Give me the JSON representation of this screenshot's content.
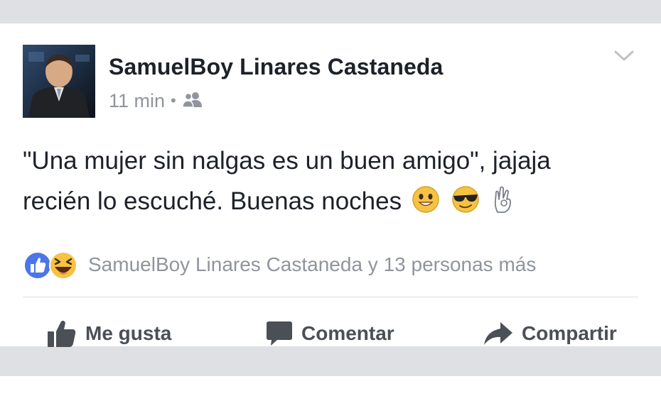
{
  "post": {
    "author": "SamuelBoy Linares Castaneda",
    "time": "11 min",
    "separator": "•",
    "audience_icon": "friends-icon",
    "text_line1": "\"Una mujer sin nalgas es un buen amigo\", jajaja",
    "text_line2": "recién lo escuché. Buenas noches",
    "emojis": [
      "smiling-face-icon",
      "sunglasses-face-icon",
      "ok-hand-icon"
    ]
  },
  "reactions": {
    "icons": [
      "like-reaction-icon",
      "haha-reaction-icon"
    ],
    "summary": "SamuelBoy Linares Castaneda y 13 personas más"
  },
  "actions": {
    "like_label": "Me gusta",
    "comment_label": "Comentar",
    "share_label": "Compartir"
  },
  "colors": {
    "like_blue": "#4a76e8",
    "text_dark": "#1d2129",
    "text_muted": "#90949c",
    "action_gray": "#4b4f56",
    "background": "#dfe0e4"
  }
}
